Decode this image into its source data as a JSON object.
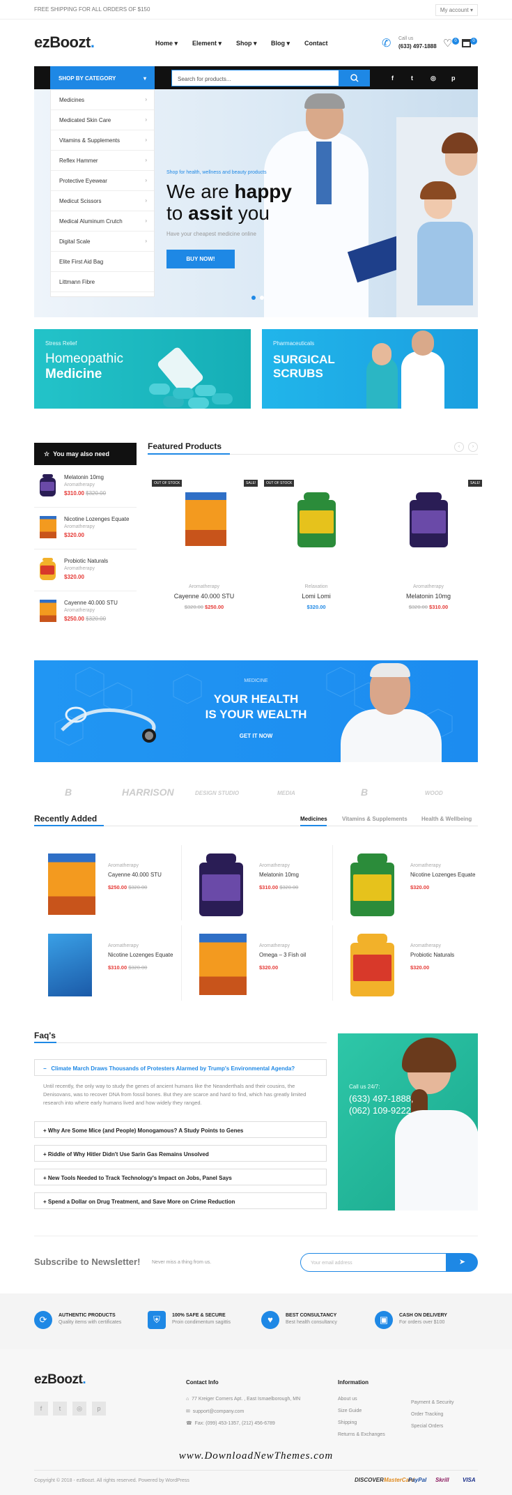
{
  "topbar": {
    "shipping": "FREE SHIPPING FOR ALL ORDERS OF $150",
    "account": "My account"
  },
  "header": {
    "logo": "ezBoozt",
    "nav": [
      "Home",
      "Element",
      "Shop",
      "Blog",
      "Contact"
    ],
    "call_label": "Call us",
    "call_number": "(633) 497-1888",
    "wishlist_count": "0",
    "cart_count": "0"
  },
  "searchbar": {
    "category_label": "SHOP BY CATEGORY",
    "placeholder": "Search for products..."
  },
  "categories": [
    "Medicines",
    "Medicated Skin Care",
    "Vitamins & Supplements",
    "Reflex Hammer",
    "Protective Eyewear",
    "Medicut Scissors",
    "Medical Aluminum Crutch",
    "Digital Scale",
    "Elite First Aid Bag",
    "Littmann Fibre"
  ],
  "hero": {
    "kicker": "Shop for health, wellness and beauty products",
    "line1_a": "We are ",
    "line1_b": "happy",
    "line2_a": "to ",
    "line2_b": "assit",
    "line2_c": " you",
    "sub": "Have your cheapest medicine online",
    "cta": "BUY NOW!"
  },
  "banners": [
    {
      "kicker": "Stress Relief",
      "title1": "Homeopathic",
      "title2": "Medicine"
    },
    {
      "kicker": "Pharmaceuticals",
      "title1": "SURGICAL",
      "title2": "SCRUBS"
    }
  ],
  "sidebar": {
    "title": "You may also need",
    "items": [
      {
        "name": "Melatonin 10mg",
        "cat": "Aromatherapy",
        "price": "$310.00",
        "old": "$320.00"
      },
      {
        "name": "Nicotine Lozenges Equate",
        "cat": "Aromatherapy",
        "price": "$320.00",
        "old": ""
      },
      {
        "name": "Probiotic Naturals",
        "cat": "Aromatherapy",
        "price": "$320.00",
        "old": ""
      },
      {
        "name": "Cayenne 40.000 STU",
        "cat": "Aromatherapy",
        "price": "$250.00",
        "old": "$320.00"
      }
    ]
  },
  "featured": {
    "title": "Featured Products",
    "products": [
      {
        "badge1": "OUT OF STOCK",
        "badge2": "SALE!",
        "cat": "Aromatherapy",
        "name": "Cayenne 40.000 STU",
        "old": "$320.00",
        "price": "$250.00"
      },
      {
        "badge1": "OUT OF STOCK",
        "badge2": "",
        "cat": "Relaxation",
        "name": "Lomi Lomi",
        "old": "",
        "price": "$320.00"
      },
      {
        "badge1": "",
        "badge2": "SALE!",
        "cat": "Aromatherapy",
        "name": "Melatonin 10mg",
        "old": "$320.00",
        "price": "$310.00"
      }
    ]
  },
  "health_banner": {
    "kicker": "MEDICINE",
    "line1": "YOUR HEALTH",
    "line2": "IS YOUR WEALTH",
    "cta": "GET IT NOW"
  },
  "brands": [
    "B",
    "HARRISON",
    "DESIGN STUDIO",
    "MEDIA",
    "B",
    "WOOD"
  ],
  "recent": {
    "title": "Recently Added",
    "tabs": [
      "Medicines",
      "Vitamins & Supplements",
      "Health & Wellbeing"
    ],
    "items": [
      {
        "cat": "Aromatherapy",
        "name": "Cayenne 40.000 STU",
        "price": "$250.00",
        "old": "$320.00"
      },
      {
        "cat": "Aromatherapy",
        "name": "Melatonin 10mg",
        "price": "$310.00",
        "old": "$320.00"
      },
      {
        "cat": "Aromatherapy",
        "name": "Nicotine Lozenges Equate",
        "price": "$320.00",
        "old": ""
      },
      {
        "cat": "Aromatherapy",
        "name": "Nicotine Lozenges Equate",
        "price": "$310.00",
        "old": "$320.00"
      },
      {
        "cat": "Aromatherapy",
        "name": "Omega – 3 Fish oil",
        "price": "$320.00",
        "old": ""
      },
      {
        "cat": "Aromatherapy",
        "name": "Probiotic Naturals",
        "price": "$320.00",
        "old": ""
      }
    ]
  },
  "faq": {
    "title": "Faq's",
    "open_q": "Climate March Draws Thousands of Protesters Alarmed by Trump's Environmental Agenda?",
    "answer": "Until recently, the only way to study the genes of ancient humans like the Neanderthals and their cousins, the Denisovans, was to recover DNA from fossil bones. But they are scarce and hard to find, which has greatly limited research into where early humans lived and how widely they ranged.",
    "questions": [
      "Why Are Some Mice (and People) Monogamous? A Study Points to Genes",
      "Riddle of Why Hitler Didn't Use Sarin Gas Remains Unsolved",
      "New Tools Needed to Track Technology's Impact on Jobs, Panel Says",
      "Spend a Dollar on Drug Treatment, and Save More on Crime Reduction"
    ],
    "call_label": "Call us 24/7:",
    "phone1": "(633) 497-1888,",
    "phone2": "(062) 109-9222"
  },
  "newsletter": {
    "title": "Subscribe to Newsletter!",
    "sub": "Never miss a thing from us.",
    "placeholder": "Your email address"
  },
  "features": [
    {
      "t": "AUTHENTIC PRODUCTS",
      "s": "Quality items with certificates"
    },
    {
      "t": "100% SAFE & SECURE",
      "s": "Proin condimentum sagittis"
    },
    {
      "t": "BEST CONSULTANCY",
      "s": "Best health consultancy"
    },
    {
      "t": "CASH ON DELIVERY",
      "s": "For orders over $100"
    }
  ],
  "footer": {
    "logo": "ezBoozt",
    "contact_title": "Contact Info",
    "address": "77 Kreiger Corners Apt. , East Ismaelborough, MN",
    "email": "support@company.com",
    "fax": "Fax: (099) 453-1357, (212) 456-6789",
    "info_title": "Information",
    "links1": [
      "About us",
      "Size Guide",
      "Shipping",
      "Returns & Exchanges"
    ],
    "links2": [
      "Payment & Security",
      "Order Tracking",
      "Special Orders"
    ],
    "watermark": "www.DownloadNewThemes.com",
    "copyright": "Copyright © 2018 - ezBoozt. All rights reserved. Powered by WordPress",
    "payments": [
      "DISCOVER",
      "MasterCard",
      "PayPal",
      "Skrill",
      "VISA"
    ]
  },
  "colors": {
    "accent": "#1e88e5",
    "teal": "#1fbfc6",
    "sale": "#e53935",
    "dark": "#111111"
  }
}
